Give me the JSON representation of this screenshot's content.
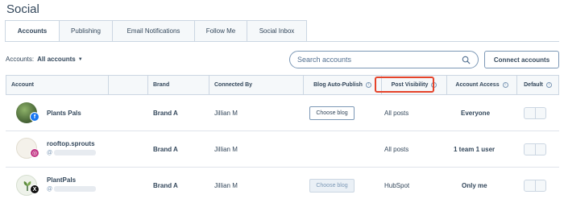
{
  "page": {
    "title": "Social"
  },
  "tabs": [
    {
      "label": "Accounts"
    },
    {
      "label": "Publishing"
    },
    {
      "label": "Email Notifications"
    },
    {
      "label": "Follow Me"
    },
    {
      "label": "Social Inbox"
    }
  ],
  "filter": {
    "label": "Accounts:",
    "value": "All accounts"
  },
  "search": {
    "placeholder": "Search accounts"
  },
  "connect_button": "Connect accounts",
  "table": {
    "headers": {
      "account": "Account",
      "brand": "Brand",
      "connected_by": "Connected By",
      "blog_auto_publish": "Blog Auto-Publish",
      "post_visibility": "Post Visibility",
      "account_access": "Account Access",
      "default": "Default"
    },
    "rows": [
      {
        "name": "Plants Pals",
        "handle": "",
        "network": "facebook",
        "brand": "Brand A",
        "connected_by": "Jillian M",
        "blog_button": "Choose blog",
        "post_visibility": "All posts",
        "account_access": "Everyone"
      },
      {
        "name": "rooftop.sprouts",
        "handle": "@",
        "network": "instagram",
        "brand": "Brand A",
        "connected_by": "Jillian M",
        "blog_button": "",
        "post_visibility": "All posts",
        "account_access": "1 team 1 user"
      },
      {
        "name": "PlantPals",
        "handle": "@",
        "network": "x",
        "brand": "Brand A",
        "connected_by": "Jillian M",
        "blog_button": "Choose blog",
        "post_visibility": "HubSpot",
        "account_access": "Only me"
      }
    ]
  },
  "colors": {
    "highlight": "#e5442b",
    "facebook": "#1877f2",
    "instagram": "#c13584",
    "x": "#111111"
  }
}
